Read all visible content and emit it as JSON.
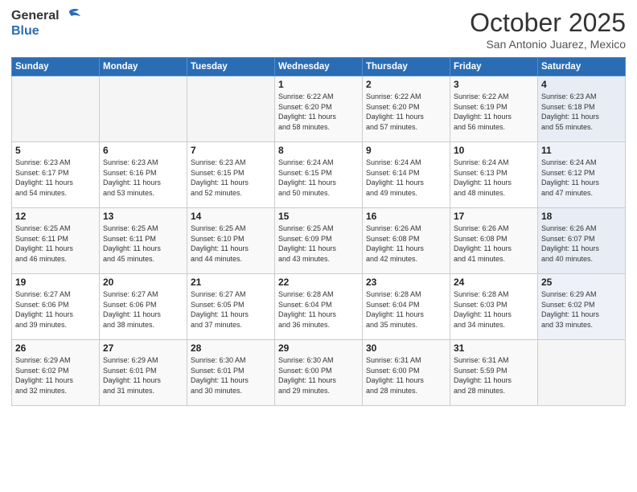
{
  "header": {
    "logo_general": "General",
    "logo_blue": "Blue",
    "month": "October 2025",
    "location": "San Antonio Juarez, Mexico"
  },
  "days_of_week": [
    "Sunday",
    "Monday",
    "Tuesday",
    "Wednesday",
    "Thursday",
    "Friday",
    "Saturday"
  ],
  "weeks": [
    [
      {
        "day": "",
        "info": ""
      },
      {
        "day": "",
        "info": ""
      },
      {
        "day": "",
        "info": ""
      },
      {
        "day": "1",
        "info": "Sunrise: 6:22 AM\nSunset: 6:20 PM\nDaylight: 11 hours\nand 58 minutes."
      },
      {
        "day": "2",
        "info": "Sunrise: 6:22 AM\nSunset: 6:20 PM\nDaylight: 11 hours\nand 57 minutes."
      },
      {
        "day": "3",
        "info": "Sunrise: 6:22 AM\nSunset: 6:19 PM\nDaylight: 11 hours\nand 56 minutes."
      },
      {
        "day": "4",
        "info": "Sunrise: 6:23 AM\nSunset: 6:18 PM\nDaylight: 11 hours\nand 55 minutes."
      }
    ],
    [
      {
        "day": "5",
        "info": "Sunrise: 6:23 AM\nSunset: 6:17 PM\nDaylight: 11 hours\nand 54 minutes."
      },
      {
        "day": "6",
        "info": "Sunrise: 6:23 AM\nSunset: 6:16 PM\nDaylight: 11 hours\nand 53 minutes."
      },
      {
        "day": "7",
        "info": "Sunrise: 6:23 AM\nSunset: 6:15 PM\nDaylight: 11 hours\nand 52 minutes."
      },
      {
        "day": "8",
        "info": "Sunrise: 6:24 AM\nSunset: 6:15 PM\nDaylight: 11 hours\nand 50 minutes."
      },
      {
        "day": "9",
        "info": "Sunrise: 6:24 AM\nSunset: 6:14 PM\nDaylight: 11 hours\nand 49 minutes."
      },
      {
        "day": "10",
        "info": "Sunrise: 6:24 AM\nSunset: 6:13 PM\nDaylight: 11 hours\nand 48 minutes."
      },
      {
        "day": "11",
        "info": "Sunrise: 6:24 AM\nSunset: 6:12 PM\nDaylight: 11 hours\nand 47 minutes."
      }
    ],
    [
      {
        "day": "12",
        "info": "Sunrise: 6:25 AM\nSunset: 6:11 PM\nDaylight: 11 hours\nand 46 minutes."
      },
      {
        "day": "13",
        "info": "Sunrise: 6:25 AM\nSunset: 6:11 PM\nDaylight: 11 hours\nand 45 minutes."
      },
      {
        "day": "14",
        "info": "Sunrise: 6:25 AM\nSunset: 6:10 PM\nDaylight: 11 hours\nand 44 minutes."
      },
      {
        "day": "15",
        "info": "Sunrise: 6:25 AM\nSunset: 6:09 PM\nDaylight: 11 hours\nand 43 minutes."
      },
      {
        "day": "16",
        "info": "Sunrise: 6:26 AM\nSunset: 6:08 PM\nDaylight: 11 hours\nand 42 minutes."
      },
      {
        "day": "17",
        "info": "Sunrise: 6:26 AM\nSunset: 6:08 PM\nDaylight: 11 hours\nand 41 minutes."
      },
      {
        "day": "18",
        "info": "Sunrise: 6:26 AM\nSunset: 6:07 PM\nDaylight: 11 hours\nand 40 minutes."
      }
    ],
    [
      {
        "day": "19",
        "info": "Sunrise: 6:27 AM\nSunset: 6:06 PM\nDaylight: 11 hours\nand 39 minutes."
      },
      {
        "day": "20",
        "info": "Sunrise: 6:27 AM\nSunset: 6:06 PM\nDaylight: 11 hours\nand 38 minutes."
      },
      {
        "day": "21",
        "info": "Sunrise: 6:27 AM\nSunset: 6:05 PM\nDaylight: 11 hours\nand 37 minutes."
      },
      {
        "day": "22",
        "info": "Sunrise: 6:28 AM\nSunset: 6:04 PM\nDaylight: 11 hours\nand 36 minutes."
      },
      {
        "day": "23",
        "info": "Sunrise: 6:28 AM\nSunset: 6:04 PM\nDaylight: 11 hours\nand 35 minutes."
      },
      {
        "day": "24",
        "info": "Sunrise: 6:28 AM\nSunset: 6:03 PM\nDaylight: 11 hours\nand 34 minutes."
      },
      {
        "day": "25",
        "info": "Sunrise: 6:29 AM\nSunset: 6:02 PM\nDaylight: 11 hours\nand 33 minutes."
      }
    ],
    [
      {
        "day": "26",
        "info": "Sunrise: 6:29 AM\nSunset: 6:02 PM\nDaylight: 11 hours\nand 32 minutes."
      },
      {
        "day": "27",
        "info": "Sunrise: 6:29 AM\nSunset: 6:01 PM\nDaylight: 11 hours\nand 31 minutes."
      },
      {
        "day": "28",
        "info": "Sunrise: 6:30 AM\nSunset: 6:01 PM\nDaylight: 11 hours\nand 30 minutes."
      },
      {
        "day": "29",
        "info": "Sunrise: 6:30 AM\nSunset: 6:00 PM\nDaylight: 11 hours\nand 29 minutes."
      },
      {
        "day": "30",
        "info": "Sunrise: 6:31 AM\nSunset: 6:00 PM\nDaylight: 11 hours\nand 28 minutes."
      },
      {
        "day": "31",
        "info": "Sunrise: 6:31 AM\nSunset: 5:59 PM\nDaylight: 11 hours\nand 28 minutes."
      },
      {
        "day": "",
        "info": ""
      }
    ]
  ]
}
